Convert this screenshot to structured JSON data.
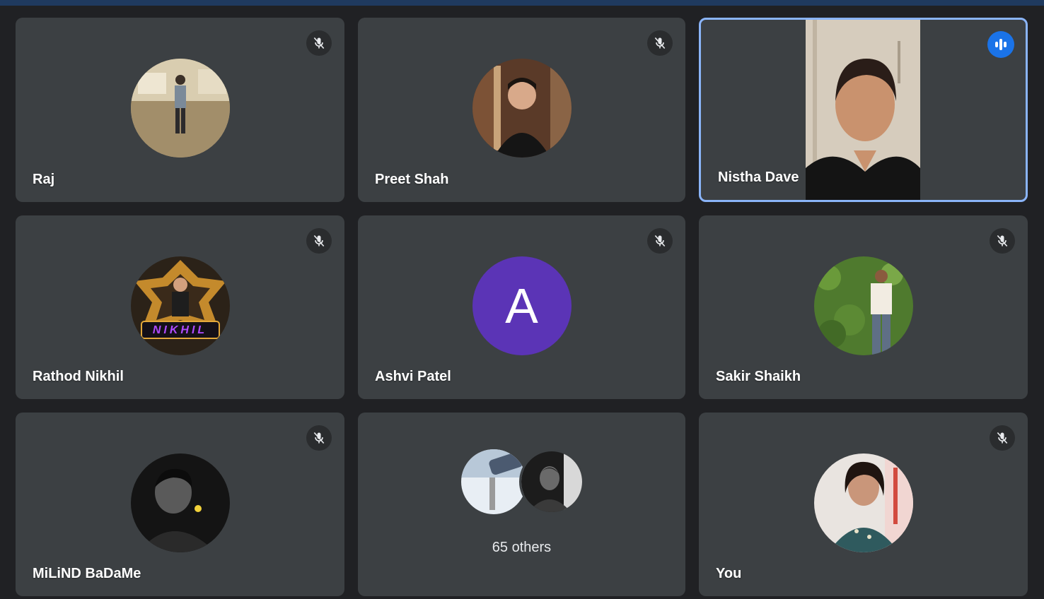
{
  "tiles": [
    {
      "name": "Raj",
      "muted": true
    },
    {
      "name": "Preet Shah",
      "muted": true
    },
    {
      "name": "Nistha Dave",
      "speaking": true
    },
    {
      "name": "Rathod Nikhil",
      "muted": true,
      "avatar_text": "NIKHIL"
    },
    {
      "name": "Ashvi Patel",
      "muted": true,
      "avatar_letter": "A"
    },
    {
      "name": "Sakir Shaikh",
      "muted": true
    },
    {
      "name": "MiLiND BaDaMe",
      "muted": true
    },
    {
      "others_label": "65 others"
    },
    {
      "name": "You",
      "muted": true
    }
  ],
  "colors": {
    "tile_bg": "#3c4043",
    "page_bg": "#202124",
    "speaking_border": "#8ab4f8",
    "speaking_badge": "#1a73e8",
    "letter_avatar": "#5b34b6"
  },
  "icons": {
    "muted": "mic-off-icon",
    "speaking": "audio-wave-icon"
  }
}
